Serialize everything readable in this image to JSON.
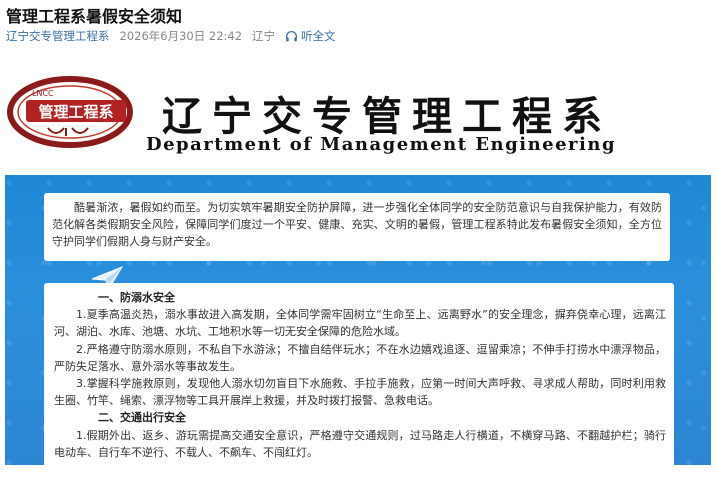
{
  "article": {
    "title": "管理工程系暑假安全须知",
    "account": "辽宁交专管理工程系",
    "datetime": "2026年6月30日 22:42",
    "location": "辽宁",
    "listen_label": "听全文"
  },
  "banner": {
    "logo_text": "管理工程系",
    "logo_abbr": "LNCC",
    "dept_cn": "辽宁交专管理工程系",
    "dept_en": "Department of Management Engineering"
  },
  "intro": "酷暑渐浓，暑假如约而至。为切实筑牢暑期安全防护屏障，进一步强化全体同学的安全防范意识与自我保护能力，有效防范化解各类假期安全风险，保障同学们度过一个平安、健康、充实、文明的暑假，管理工程系特此发布暑假安全须知，全方位守护同学们假期人身与财产安全。",
  "sections": [
    {
      "heading": "一、防溺水安全",
      "paragraphs": [
        "1.夏季高温炎热，溺水事故进入高发期，全体同学需牢固树立“生命至上、远离野水”的安全理念，摒弃侥幸心理，远离江河、湖泊、水库、池塘、水坑、工地积水等一切无安全保障的危险水域。",
        "2.严格遵守防溺水原则，不私自下水游泳；不擅自结伴玩水；不在水边嬉戏追逐、逗留乘凉；不伸手打捞水中漂浮物品，严防失足落水、意外溺水等事故发生。",
        "3.掌握科学施救原则，发现他人溺水切勿盲目下水施救、手拉手施救，应第一时间大声呼救、寻求成人帮助，同时利用救生圈、竹竿、绳索、漂浮物等工具开展岸上救援，并及时拨打报警、急救电话。"
      ]
    },
    {
      "heading": "二、交通出行安全",
      "paragraphs": [
        "1.假期外出、返乡、游玩需提高交通安全意识，严格遵守交通规则，过马路走人行横道，不横穿马路、不翻越护栏；骑行电动车、自行车不逆行、不载人、不飙车、不闯红灯。"
      ]
    }
  ],
  "colors": {
    "accent_blue": "#2b8fdc",
    "logo_red": "#c0392b",
    "link_blue": "#3a6ea5"
  }
}
